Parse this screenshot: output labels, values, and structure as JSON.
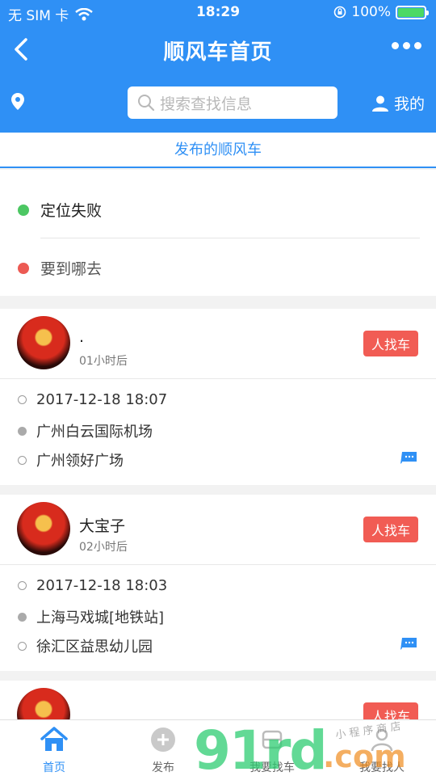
{
  "status_bar": {
    "carrier": "无 SIM 卡",
    "time": "18:29",
    "battery_pct": "100%",
    "battery_level": 1.0
  },
  "nav": {
    "title": "顺风车首页"
  },
  "search": {
    "placeholder": "搜索查找信息",
    "mine_label": "我的"
  },
  "section_tab": {
    "label": "发布的顺风车"
  },
  "route": {
    "from": "定位失败",
    "to": "要到哪去"
  },
  "colors": {
    "primary": "#2f90f5",
    "tag": "#f15c54",
    "origin_dot": "#4cc763",
    "dest_dot": "#ec5a53"
  },
  "cards": [
    {
      "name": ".",
      "when": "01小时后",
      "tag": "人找车",
      "datetime": "2017-12-18 18:07",
      "from": "广州白云国际机场",
      "to": "广州领好广场"
    },
    {
      "name": "大宝子",
      "when": "02小时后",
      "tag": "人找车",
      "datetime": "2017-12-18 18:03",
      "from": "上海马戏城[地铁站]",
      "to": "徐汇区益思幼儿园"
    },
    {
      "name": "",
      "when": "",
      "tag": "人找车"
    }
  ],
  "bottom_nav": [
    {
      "label": "首页",
      "icon": "home-icon"
    },
    {
      "label": "发布",
      "icon": "plus-circle-icon"
    },
    {
      "label": "我要找车",
      "icon": "car-icon"
    },
    {
      "label": "我要找人",
      "icon": "person-icon"
    }
  ],
  "watermark": {
    "main": "91rd",
    "suffix": ".com",
    "small": "小 程 序 商 店"
  }
}
